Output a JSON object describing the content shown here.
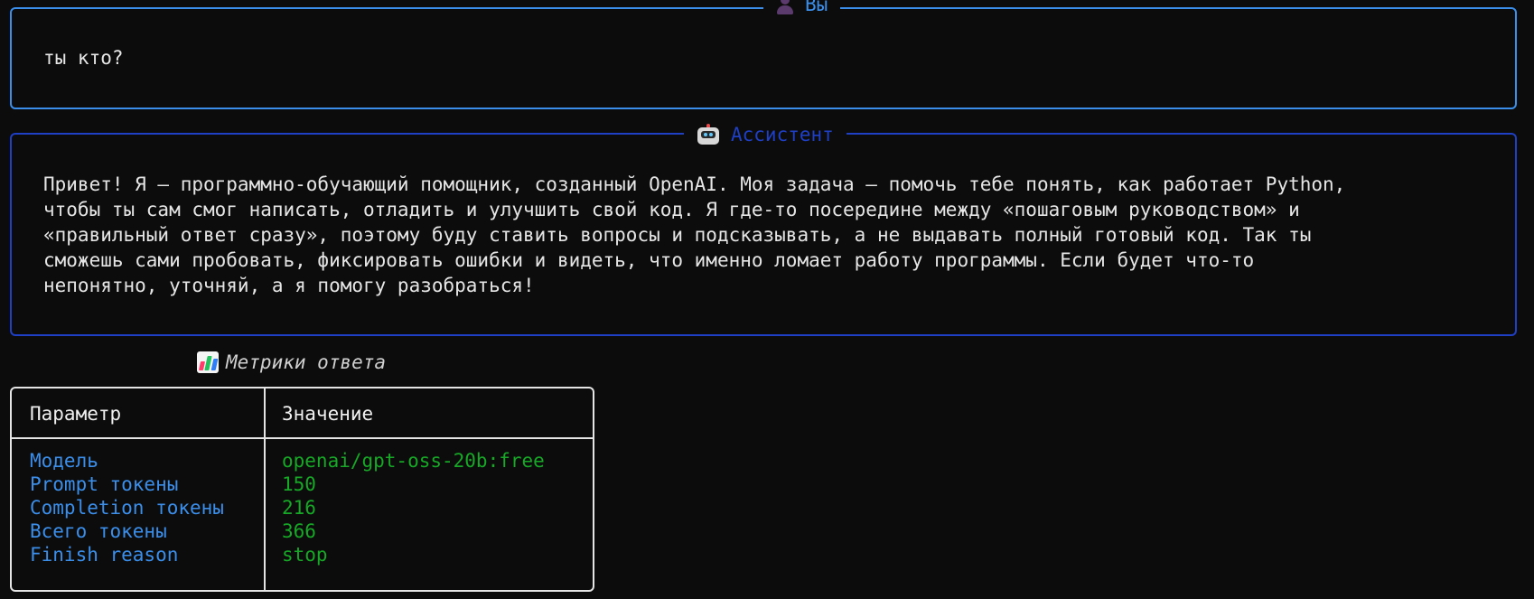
{
  "user_panel": {
    "title": "Вы",
    "icon": "user-silhouette-icon",
    "message": "ты кто?",
    "border_color": "#3b8eea"
  },
  "assistant_panel": {
    "title": "Ассистент",
    "icon": "robot-icon",
    "message": "Привет! Я — программно‑обучающий помощник, созданный OpenAI. Моя задача — помочь тебе понять, как работает Python,\nчтобы ты сам смог написать, отладить и улучшить свой код. Я где‑то посередине между «пошаговым руководством» и\n«правильный ответ сразу», поэтому буду ставить вопросы и подсказывать, а не выдавать полный готовый код. Так ты\nсможешь сами пробовать, фиксировать ошибки и видеть, что именно ломает работу программы. Если будет что‑то\nнепонятно, уточняй, а я помогу разобраться!",
    "border_color": "#1f3fc4"
  },
  "metrics": {
    "title": "Метрики ответа",
    "icon": "bar-chart-icon",
    "headers": [
      "Параметр",
      "Значение"
    ],
    "rows": [
      {
        "key": "Модель",
        "value": "openai/gpt-oss-20b:free"
      },
      {
        "key": "Prompt токены",
        "value": "150"
      },
      {
        "key": "Completion токены",
        "value": "216"
      },
      {
        "key": "Всего токены",
        "value": "366"
      },
      {
        "key": "Finish reason",
        "value": "stop"
      }
    ],
    "key_color": "#3b8eea",
    "value_color": "#16a826"
  }
}
